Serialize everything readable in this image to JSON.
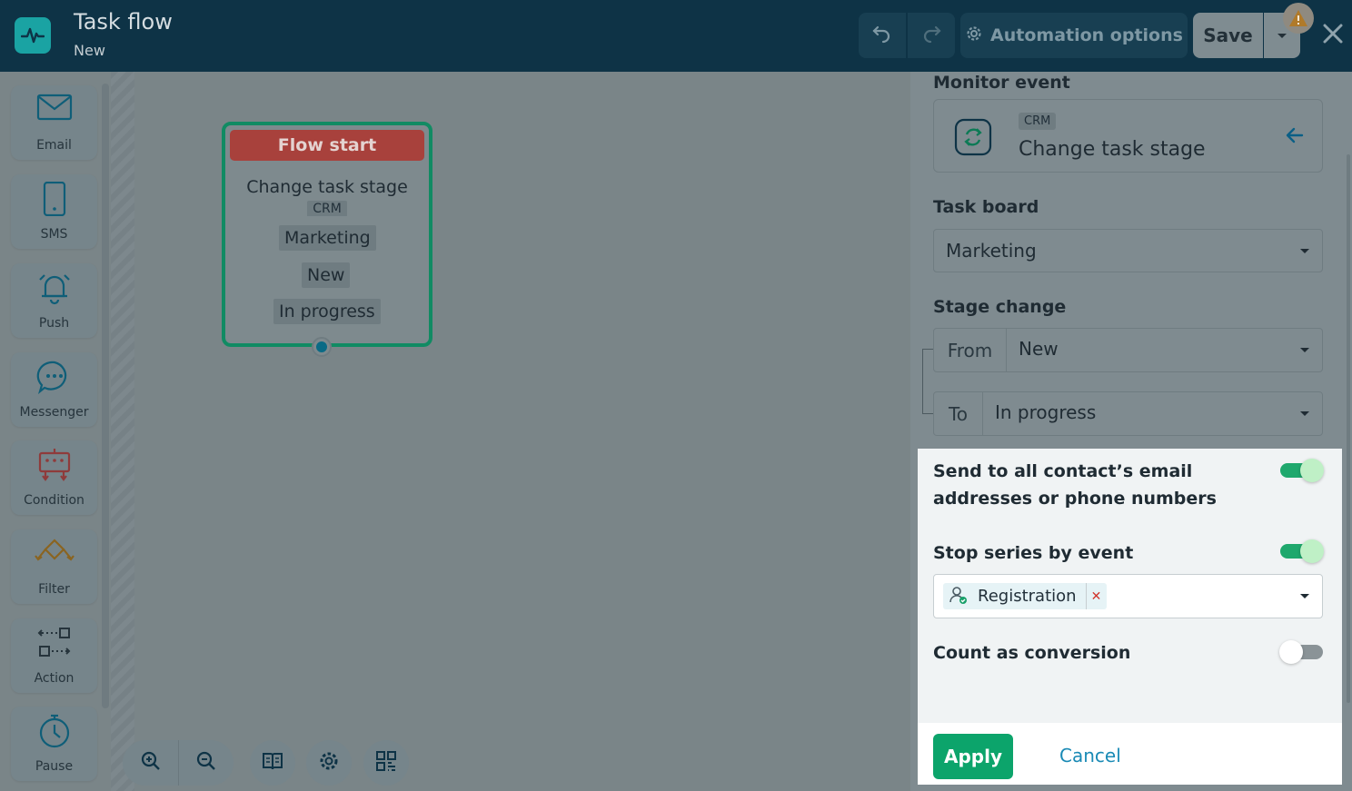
{
  "header": {
    "title": "Task flow",
    "subtitle": "New",
    "automation_label": "Automation options",
    "save_label": "Save"
  },
  "toolbox": {
    "items": [
      {
        "label": "Email",
        "icon": "envelope-icon"
      },
      {
        "label": "SMS",
        "icon": "phone-icon"
      },
      {
        "label": "Push",
        "icon": "bell-icon"
      },
      {
        "label": "Messenger",
        "icon": "chat-bubble-icon"
      },
      {
        "label": "Condition",
        "icon": "condition-icon"
      },
      {
        "label": "Filter",
        "icon": "filter-icon"
      },
      {
        "label": "Action",
        "icon": "action-icon"
      },
      {
        "label": "Pause",
        "icon": "stopwatch-icon"
      }
    ]
  },
  "node": {
    "header": "Flow start",
    "title": "Change task stage",
    "crm_tag": "CRM",
    "board": "Marketing",
    "from": "New",
    "to": "In progress"
  },
  "panel": {
    "monitor_label": "Monitor event",
    "event_tag": "CRM",
    "event_name": "Change task stage",
    "board_label": "Task board",
    "board_value": "Marketing",
    "stage_label": "Stage change",
    "from_label": "From",
    "from_value": "New",
    "to_label": "To",
    "to_value": "In progress",
    "send_all_label": "Send to all contact’s email addresses or phone numbers",
    "send_all_on": true,
    "stop_series_label": "Stop series by event",
    "stop_series_on": true,
    "stop_event_tag": "Registration",
    "conversion_label": "Count as conversion",
    "conversion_on": false,
    "apply_label": "Apply",
    "cancel_label": "Cancel"
  },
  "colors": {
    "header_bg": "#0e3346",
    "accent_green": "#0ca46b",
    "flow_start_red": "#a8413c",
    "link_blue": "#1a8ab5"
  }
}
